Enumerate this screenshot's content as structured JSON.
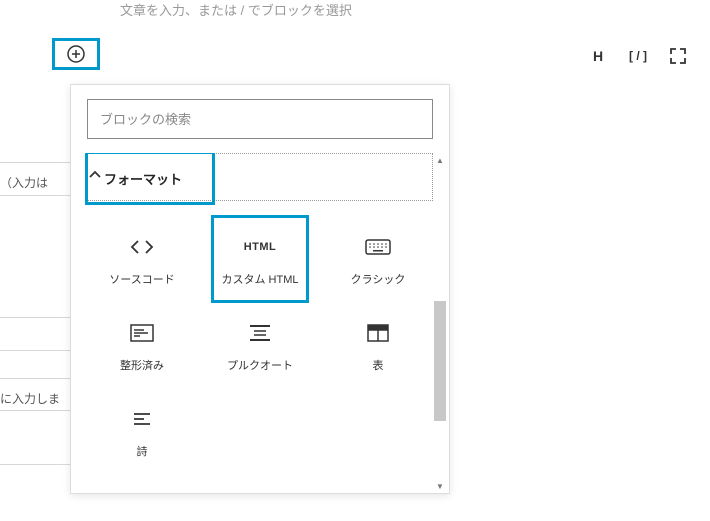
{
  "editor": {
    "placeholder": "文章を入力、または / でブロックを選択"
  },
  "toolbar": {
    "heading_label": "H",
    "code_label": "[ / ]"
  },
  "search": {
    "placeholder": "ブロックの検索"
  },
  "category": {
    "name": "フォーマット"
  },
  "blocks": [
    {
      "label": "ソースコード",
      "icon": "code"
    },
    {
      "label": "カスタム HTML",
      "icon": "html"
    },
    {
      "label": "クラシック",
      "icon": "keyboard"
    },
    {
      "label": "整形済み",
      "icon": "preformatted"
    },
    {
      "label": "プルクオート",
      "icon": "pullquote"
    },
    {
      "label": "表",
      "icon": "table"
    },
    {
      "label": "詩",
      "icon": "verse"
    }
  ],
  "bg_labels": {
    "input_label": "（入力は",
    "enter_label": "に入力しま"
  }
}
